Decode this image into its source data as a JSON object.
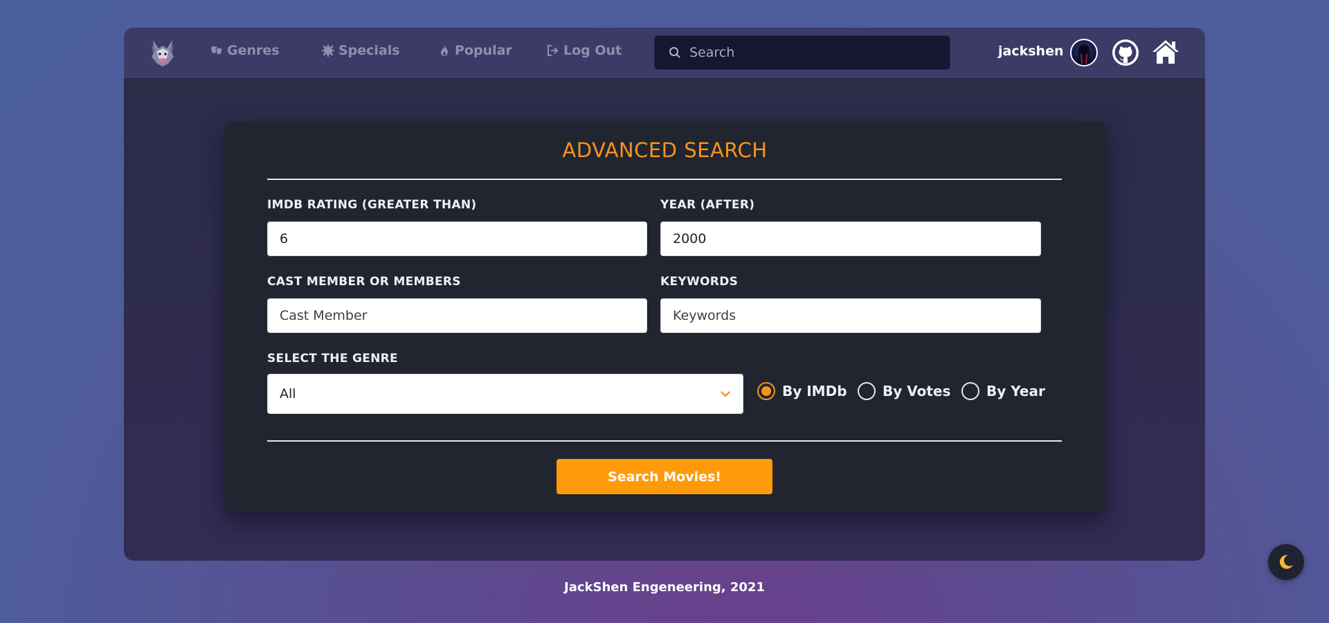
{
  "nav": {
    "logo_icon": "fox-logo-icon",
    "items": [
      {
        "label": "Genres",
        "icon": "masks-icon"
      },
      {
        "label": "Specials",
        "icon": "gear-icon"
      },
      {
        "label": "Popular",
        "icon": "fire-icon"
      },
      {
        "label": "Log Out",
        "icon": "logout-icon"
      }
    ],
    "search_placeholder": "Search",
    "username": "jackshen",
    "avatar_icon": "user-avatar",
    "github_icon": "github-icon",
    "home_icon": "home-icon"
  },
  "form": {
    "title": "ADVANCED SEARCH",
    "rating_label": "IMDB RATING (GREATER THAN)",
    "rating_value": "6",
    "year_label": "YEAR (AFTER)",
    "year_value": "2000",
    "cast_label": "CAST MEMBER OR MEMBERS",
    "cast_placeholder": "Cast Member",
    "keywords_label": "KEYWORDS",
    "keywords_placeholder": "Keywords",
    "genre_label": "SELECT THE GENRE",
    "genre_selected": "All",
    "sort_options": [
      {
        "label": "By IMDb",
        "checked": true
      },
      {
        "label": "By Votes",
        "checked": false
      },
      {
        "label": "By Year",
        "checked": false
      }
    ],
    "submit_label": "Search Movies!"
  },
  "footer": {
    "text": "JackShen Engeneering, 2021"
  },
  "theme_toggle_icon": "moon-icon",
  "colors": {
    "accent": "#f7941e",
    "button": "#ff9a0b",
    "navbar": "#3c3b68",
    "card": "#212530"
  }
}
